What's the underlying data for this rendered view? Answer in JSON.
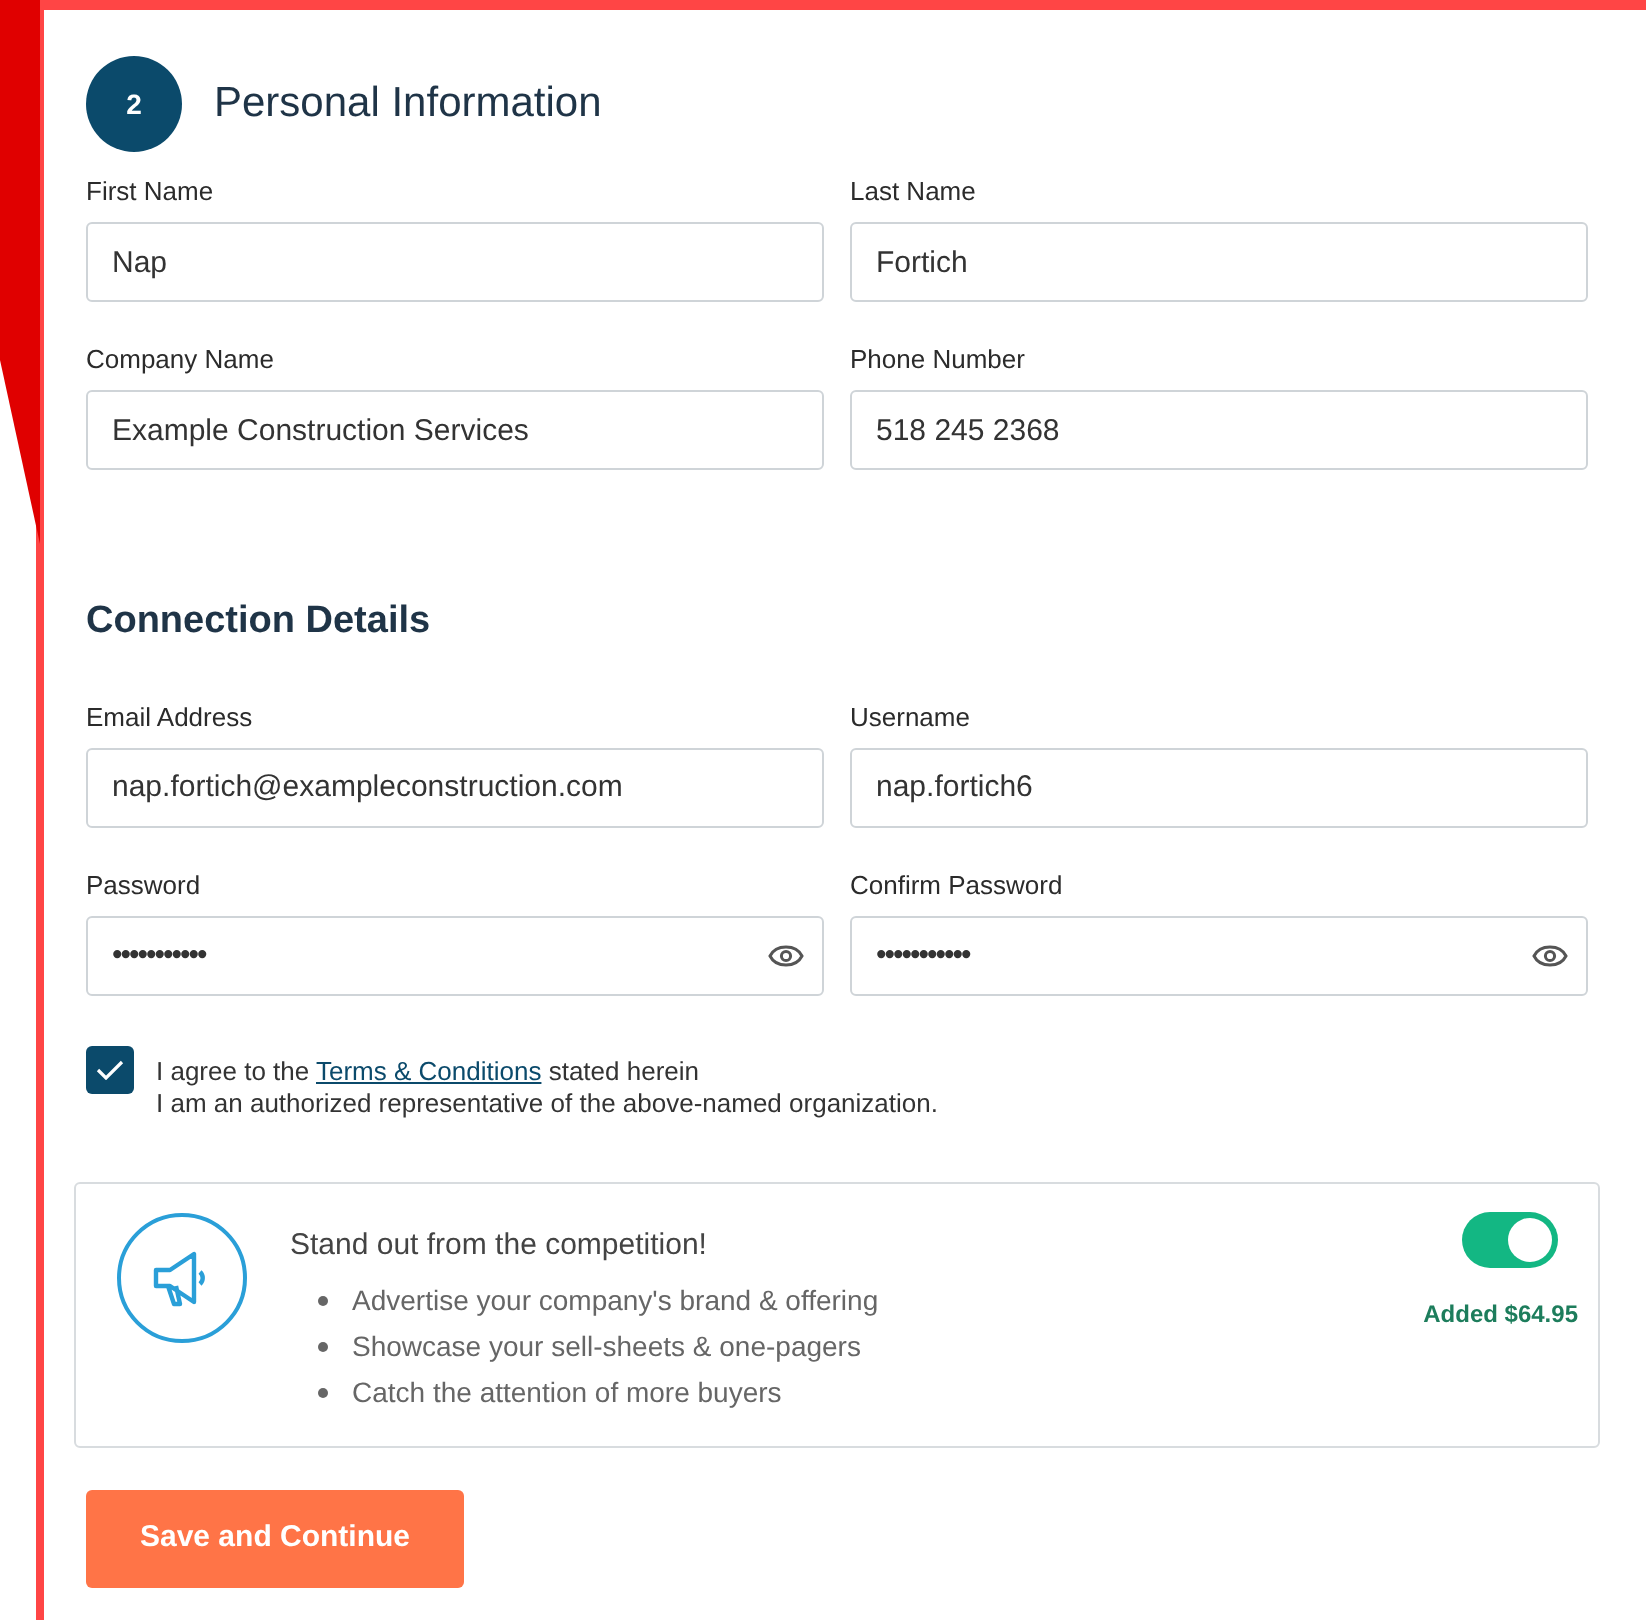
{
  "step": {
    "number": "2",
    "title": "Personal Information"
  },
  "sections": [
    {
      "fields": [
        {
          "label": "First Name",
          "value": "Nap",
          "kind": "text"
        },
        {
          "label": "Last Name",
          "value": "Fortich",
          "kind": "text"
        },
        {
          "label": "Company Name",
          "value": "Example Construction Services",
          "kind": "text"
        },
        {
          "label": "Phone Number",
          "value": "518 245 2368",
          "kind": "text"
        }
      ]
    },
    {
      "title": "Connection Details",
      "fields": [
        {
          "label": "Email Address",
          "value": "nap.fortich@exampleconstruction.com",
          "kind": "text"
        },
        {
          "label": "Username",
          "value": "nap.fortich6",
          "kind": "text"
        },
        {
          "label": "Password",
          "value": "•••••••••••",
          "kind": "password"
        },
        {
          "label": "Confirm Password",
          "value": "•••••••••••",
          "kind": "password"
        }
      ]
    }
  ],
  "agreement": {
    "checked": true,
    "before_link": "I agree to the",
    "link": "Terms & Conditions",
    "after_link": "stated herein",
    "line_2": "I am an authorized representative of the above-named organization."
  },
  "promo": {
    "title": "Stand out from the competition!",
    "bullets": [
      "Advertise your company's brand & offering",
      "Showcase your sell-sheets & one-pagers",
      "Catch the attention of more buyers"
    ],
    "on": true,
    "note": "Added $64.95"
  },
  "button": "Save and Continue"
}
